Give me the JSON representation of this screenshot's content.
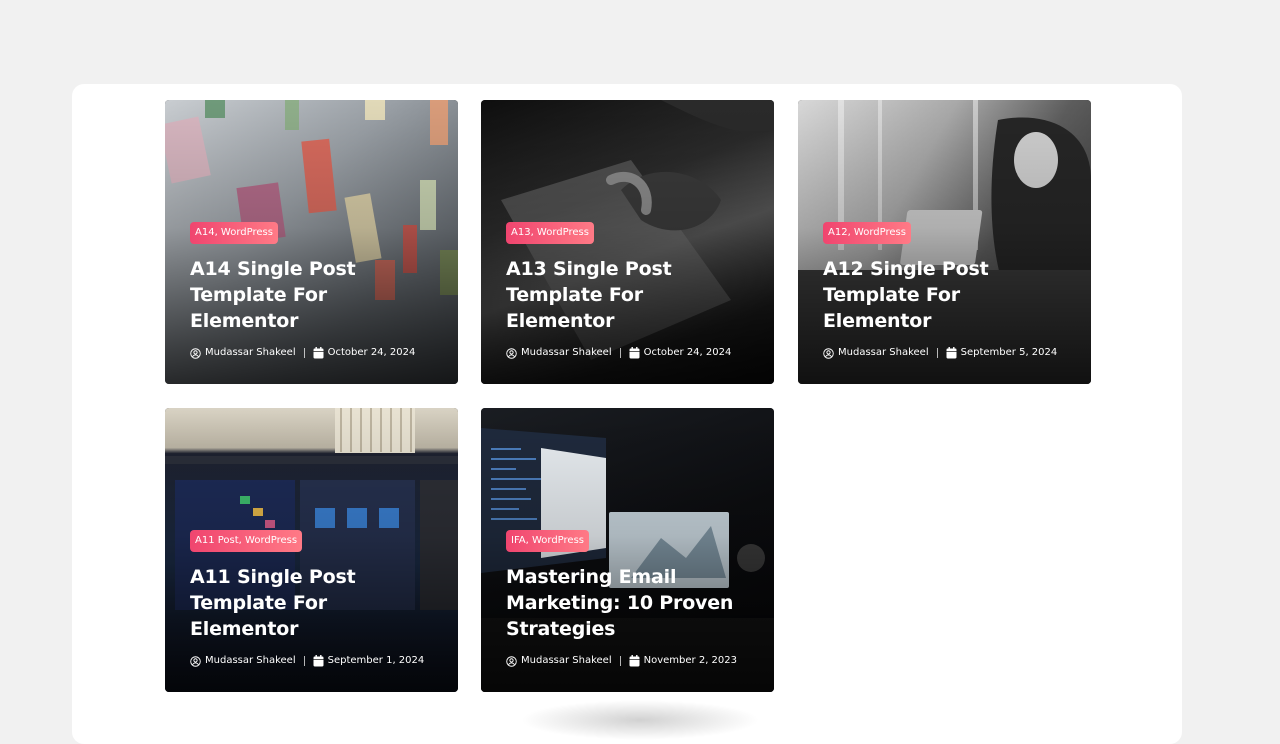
{
  "posts": [
    {
      "category": "A14, WordPress",
      "title": "A14 Single Post Template For Elementor",
      "author": "Mudassar Shakeel",
      "date": "October 24, 2024"
    },
    {
      "category": "A13, WordPress",
      "title": "A13 Single Post Template For Elementor",
      "author": "Mudassar Shakeel",
      "date": "October 24, 2024"
    },
    {
      "category": "A12, WordPress",
      "title": "A12 Single Post Template For Elementor",
      "author": "Mudassar Shakeel",
      "date": "September 5, 2024"
    },
    {
      "category": "A11 Post, WordPress",
      "title": "A11 Single Post Template For Elementor",
      "author": "Mudassar Shakeel",
      "date": "September 1, 2024"
    },
    {
      "category": "IFA, WordPress",
      "title": "Mastering Email Marketing: 10 Proven Strategies",
      "author": "Mudassar Shakeel",
      "date": "November 2, 2023"
    }
  ],
  "icons": {
    "author": "user-circle-icon",
    "date": "calendar-icon"
  },
  "colors": {
    "page_background": "#f1f1f1",
    "panel_background": "#ffffff",
    "badge_gradient_start": "#f0456f",
    "badge_gradient_end": "#ff7a86",
    "card_text": "#ffffff"
  }
}
